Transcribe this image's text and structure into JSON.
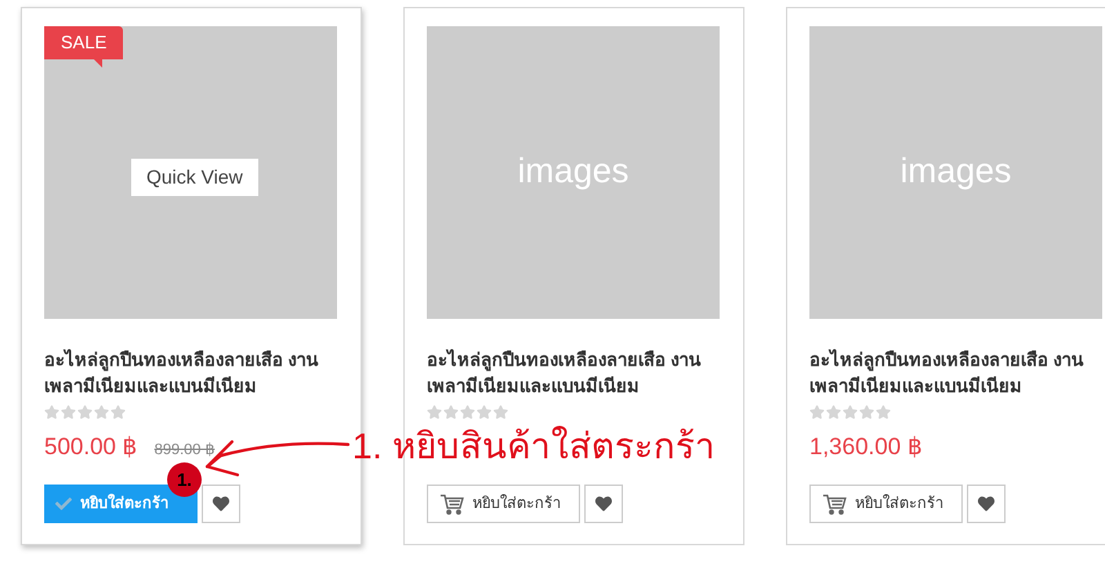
{
  "products": [
    {
      "sale_badge": "SALE",
      "quick_view": "Quick View",
      "hovered": true,
      "title": "อะไหล่ลูกปืนทองเหลืองลายเสือ งานเพลามีเนียมและแบนมีเนียม",
      "stars": 0,
      "price": "500.00 ฿",
      "old_price": "899.00 ฿",
      "cart_button": {
        "label": "หยิบใส่ตะกร้า",
        "added": true
      }
    },
    {
      "image_label": "images",
      "hovered": false,
      "title": "อะไหล่ลูกปืนทองเหลืองลายเสือ งานเพลามีเนียมและแบนมีเนียม",
      "stars": 0,
      "cart_button": {
        "label": "หยิบใส่ตะกร้า",
        "added": false
      }
    },
    {
      "image_label": "images",
      "hovered": false,
      "title": "อะไหล่ลูกปืนทองเหลืองลายเสือ งานเพลามีเนียมและแบนมีเนียม",
      "stars": 0,
      "price": "1,360.00 ฿",
      "cart_button": {
        "label": "หยิบใส่ตะกร้า",
        "added": false
      }
    }
  ],
  "annotation": {
    "text": "1. หยิบสินค้าใส่ตระกร้า",
    "marker": "1."
  }
}
